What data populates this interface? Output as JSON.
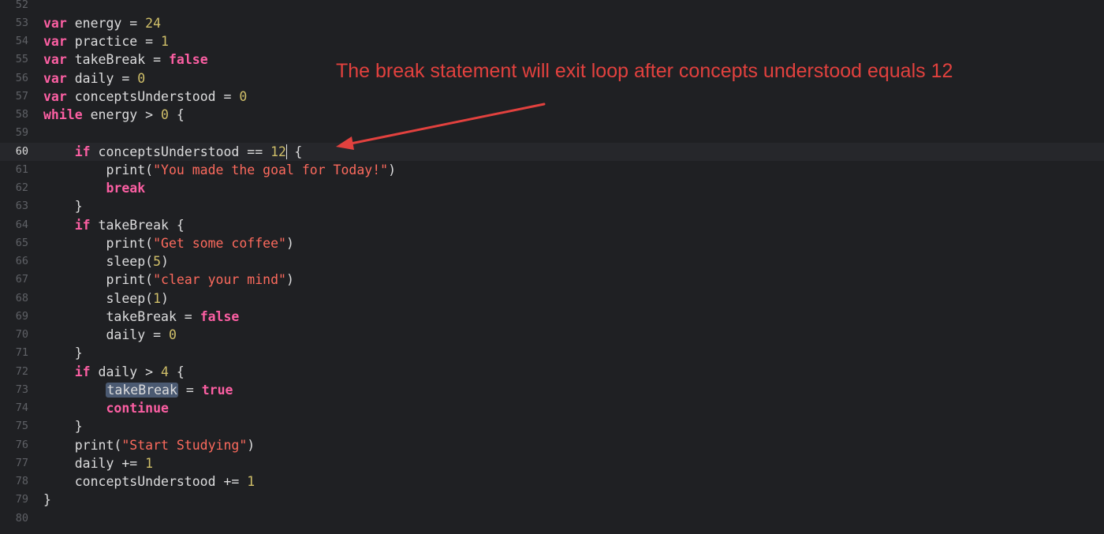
{
  "annotation": {
    "text": "The break statement will exit loop after concepts understood equals 12",
    "color": "#e2413e"
  },
  "colors": {
    "background": "#1f2023",
    "keyword": "#fc5fa3",
    "string": "#fc6a5d",
    "number": "#d0bf69",
    "plain": "#dcdcdd",
    "selection": "#4b5a72"
  },
  "current_line": 60,
  "selected_token": "takeBreak",
  "lines": [
    {
      "n": "52",
      "tokens": []
    },
    {
      "n": "53",
      "tokens": [
        {
          "t": "kw",
          "v": "var"
        },
        {
          "t": "plain",
          "v": " energy = "
        },
        {
          "t": "num",
          "v": "24"
        }
      ]
    },
    {
      "n": "54",
      "tokens": [
        {
          "t": "kw",
          "v": "var"
        },
        {
          "t": "plain",
          "v": " practice = "
        },
        {
          "t": "num",
          "v": "1"
        }
      ]
    },
    {
      "n": "55",
      "tokens": [
        {
          "t": "kw",
          "v": "var"
        },
        {
          "t": "plain",
          "v": " takeBreak = "
        },
        {
          "t": "kw",
          "v": "false"
        }
      ]
    },
    {
      "n": "56",
      "tokens": [
        {
          "t": "kw",
          "v": "var"
        },
        {
          "t": "plain",
          "v": " daily = "
        },
        {
          "t": "num",
          "v": "0"
        }
      ]
    },
    {
      "n": "57",
      "tokens": [
        {
          "t": "kw",
          "v": "var"
        },
        {
          "t": "plain",
          "v": " conceptsUnderstood = "
        },
        {
          "t": "num",
          "v": "0"
        }
      ]
    },
    {
      "n": "58",
      "tokens": [
        {
          "t": "kw",
          "v": "while"
        },
        {
          "t": "plain",
          "v": " energy > "
        },
        {
          "t": "num",
          "v": "0"
        },
        {
          "t": "plain",
          "v": " {"
        }
      ]
    },
    {
      "n": "59",
      "tokens": []
    },
    {
      "n": "60",
      "tokens": [
        {
          "t": "plain",
          "v": "    "
        },
        {
          "t": "kw",
          "v": "if"
        },
        {
          "t": "plain",
          "v": " conceptsUnderstood == "
        },
        {
          "t": "num",
          "v": "12"
        },
        {
          "t": "cursor",
          "v": ""
        },
        {
          "t": "plain",
          "v": " {"
        }
      ]
    },
    {
      "n": "61",
      "tokens": [
        {
          "t": "plain",
          "v": "        print("
        },
        {
          "t": "str",
          "v": "\"You made the goal for Today!\""
        },
        {
          "t": "plain",
          "v": ")"
        }
      ]
    },
    {
      "n": "62",
      "tokens": [
        {
          "t": "plain",
          "v": "        "
        },
        {
          "t": "kw",
          "v": "break"
        }
      ]
    },
    {
      "n": "63",
      "tokens": [
        {
          "t": "plain",
          "v": "    }"
        }
      ]
    },
    {
      "n": "64",
      "tokens": [
        {
          "t": "plain",
          "v": "    "
        },
        {
          "t": "kw",
          "v": "if"
        },
        {
          "t": "plain",
          "v": " takeBreak {"
        }
      ]
    },
    {
      "n": "65",
      "tokens": [
        {
          "t": "plain",
          "v": "        print("
        },
        {
          "t": "str",
          "v": "\"Get some coffee\""
        },
        {
          "t": "plain",
          "v": ")"
        }
      ]
    },
    {
      "n": "66",
      "tokens": [
        {
          "t": "plain",
          "v": "        sleep("
        },
        {
          "t": "num",
          "v": "5"
        },
        {
          "t": "plain",
          "v": ")"
        }
      ]
    },
    {
      "n": "67",
      "tokens": [
        {
          "t": "plain",
          "v": "        print("
        },
        {
          "t": "str",
          "v": "\"clear your mind\""
        },
        {
          "t": "plain",
          "v": ")"
        }
      ]
    },
    {
      "n": "68",
      "tokens": [
        {
          "t": "plain",
          "v": "        sleep("
        },
        {
          "t": "num",
          "v": "1"
        },
        {
          "t": "plain",
          "v": ")"
        }
      ]
    },
    {
      "n": "69",
      "tokens": [
        {
          "t": "plain",
          "v": "        takeBreak = "
        },
        {
          "t": "kw",
          "v": "false"
        }
      ]
    },
    {
      "n": "70",
      "tokens": [
        {
          "t": "plain",
          "v": "        daily = "
        },
        {
          "t": "num",
          "v": "0"
        }
      ]
    },
    {
      "n": "71",
      "tokens": [
        {
          "t": "plain",
          "v": "    }"
        }
      ]
    },
    {
      "n": "72",
      "tokens": [
        {
          "t": "plain",
          "v": "    "
        },
        {
          "t": "kw",
          "v": "if"
        },
        {
          "t": "plain",
          "v": " daily > "
        },
        {
          "t": "num",
          "v": "4"
        },
        {
          "t": "plain",
          "v": " {"
        }
      ]
    },
    {
      "n": "73",
      "tokens": [
        {
          "t": "plain",
          "v": "        "
        },
        {
          "t": "sel",
          "v": "takeBreak"
        },
        {
          "t": "plain",
          "v": " = "
        },
        {
          "t": "kw",
          "v": "true"
        }
      ]
    },
    {
      "n": "74",
      "tokens": [
        {
          "t": "plain",
          "v": "        "
        },
        {
          "t": "kw",
          "v": "continue"
        }
      ]
    },
    {
      "n": "75",
      "tokens": [
        {
          "t": "plain",
          "v": "    }"
        }
      ]
    },
    {
      "n": "76",
      "tokens": [
        {
          "t": "plain",
          "v": "    print("
        },
        {
          "t": "str",
          "v": "\"Start Studying\""
        },
        {
          "t": "plain",
          "v": ")"
        }
      ]
    },
    {
      "n": "77",
      "tokens": [
        {
          "t": "plain",
          "v": "    daily += "
        },
        {
          "t": "num",
          "v": "1"
        }
      ]
    },
    {
      "n": "78",
      "tokens": [
        {
          "t": "plain",
          "v": "    conceptsUnderstood += "
        },
        {
          "t": "num",
          "v": "1"
        }
      ]
    },
    {
      "n": "79",
      "tokens": [
        {
          "t": "plain",
          "v": "}"
        }
      ]
    },
    {
      "n": "80",
      "tokens": []
    }
  ]
}
